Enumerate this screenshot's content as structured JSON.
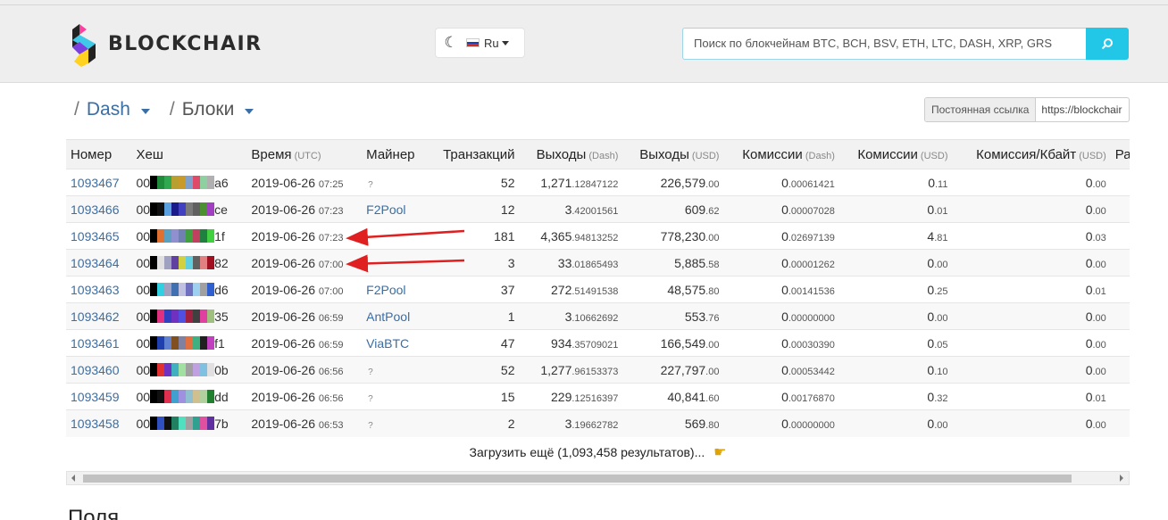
{
  "header": {
    "logo_text": "BLOCKCHAIR",
    "theme_icon": "moon-icon",
    "language": "Ru",
    "search_placeholder": "Поиск по блокчейнам BTC, BCH, BSV, ETH, LTC, DASH, XRP, GRS"
  },
  "breadcrumb": {
    "chain": "Dash",
    "section": "Блоки"
  },
  "permalink": {
    "label": "Постоянная ссылка",
    "value": "https://blockchair"
  },
  "table": {
    "columns": [
      {
        "label": "Номер",
        "unit": ""
      },
      {
        "label": "Хеш",
        "unit": ""
      },
      {
        "label": "Время",
        "unit": "(UTC)"
      },
      {
        "label": "Майнер",
        "unit": ""
      },
      {
        "label": "Транзакций",
        "unit": ""
      },
      {
        "label": "Выходы",
        "unit": "(Dash)"
      },
      {
        "label": "Выходы",
        "unit": "(USD)"
      },
      {
        "label": "Комиссии",
        "unit": "(Dash)"
      },
      {
        "label": "Комиссии",
        "unit": "(USD)"
      },
      {
        "label": "Комиссия/Кбайт",
        "unit": "(USD)"
      },
      {
        "label": "Размер",
        "unit": ""
      }
    ],
    "rows": [
      {
        "id": "1093467",
        "hash_prefix": "00",
        "hash_suffix": "a6",
        "colors": [
          "#000000",
          "#1e8c3a",
          "#2fa84f",
          "#b8a030",
          "#c89a2a",
          "#7fa0c8",
          "#e04a6a",
          "#8fd0a0",
          "#b0b0b0"
        ],
        "date": "2019-06-26",
        "time": "07:25",
        "miner": "?",
        "tx": "52",
        "out_dash_int": "1,271",
        "out_dash_dec": ".12847122",
        "out_usd_int": "226,579",
        "out_usd_dec": ".00",
        "fee_dash_int": "0",
        "fee_dash_dec": ".00061421",
        "fee_usd_int": "0",
        "fee_usd_dec": ".11",
        "fee_kb_int": "0",
        "fee_kb_dec": ".00"
      },
      {
        "id": "1093466",
        "hash_prefix": "00",
        "hash_suffix": "ce",
        "colors": [
          "#000000",
          "#101010",
          "#5aa0e0",
          "#1a1a8a",
          "#4040c0",
          "#7a7a7a",
          "#606060",
          "#4a9030",
          "#a040c0"
        ],
        "date": "2019-06-26",
        "time": "07:23",
        "miner": "F2Pool",
        "tx": "12",
        "out_dash_int": "3",
        "out_dash_dec": ".42001561",
        "out_usd_int": "609",
        "out_usd_dec": ".62",
        "fee_dash_int": "0",
        "fee_dash_dec": ".00007028",
        "fee_usd_int": "0",
        "fee_usd_dec": ".01",
        "fee_kb_int": "0",
        "fee_kb_dec": ".00"
      },
      {
        "id": "1093465",
        "hash_prefix": "00",
        "hash_suffix": "1f",
        "colors": [
          "#000000",
          "#e07030",
          "#5aa0c0",
          "#9090d0",
          "#7080b0",
          "#40a040",
          "#c04060",
          "#208040",
          "#40d040"
        ],
        "date": "2019-06-26",
        "time": "07:23",
        "miner": "",
        "tx": "181",
        "out_dash_int": "4,365",
        "out_dash_dec": ".94813252",
        "out_usd_int": "778,230",
        "out_usd_dec": ".00",
        "fee_dash_int": "0",
        "fee_dash_dec": ".02697139",
        "fee_usd_int": "4",
        "fee_usd_dec": ".81",
        "fee_kb_int": "0",
        "fee_kb_dec": ".03"
      },
      {
        "id": "1093464",
        "hash_prefix": "00",
        "hash_suffix": "82",
        "colors": [
          "#000000",
          "#e0e0e0",
          "#a0a0c0",
          "#6040a0",
          "#d0d040",
          "#60d0e0",
          "#606060",
          "#e08080",
          "#a01020"
        ],
        "date": "2019-06-26",
        "time": "07:00",
        "miner": "",
        "tx": "3",
        "out_dash_int": "33",
        "out_dash_dec": ".01865493",
        "out_usd_int": "5,885",
        "out_usd_dec": ".58",
        "fee_dash_int": "0",
        "fee_dash_dec": ".00001262",
        "fee_usd_int": "0",
        "fee_usd_dec": ".00",
        "fee_kb_int": "0",
        "fee_kb_dec": ".00"
      },
      {
        "id": "1093463",
        "hash_prefix": "00",
        "hash_suffix": "d6",
        "colors": [
          "#000000",
          "#30d0e0",
          "#a0a0c0",
          "#4070b0",
          "#c0c0e0",
          "#7070c0",
          "#a0d0f0",
          "#a0a0a0",
          "#3060d0"
        ],
        "date": "2019-06-26",
        "time": "07:00",
        "miner": "F2Pool",
        "tx": "37",
        "out_dash_int": "272",
        "out_dash_dec": ".51491538",
        "out_usd_int": "48,575",
        "out_usd_dec": ".80",
        "fee_dash_int": "0",
        "fee_dash_dec": ".00141536",
        "fee_usd_int": "0",
        "fee_usd_dec": ".25",
        "fee_kb_int": "0",
        "fee_kb_dec": ".01"
      },
      {
        "id": "1093462",
        "hash_prefix": "00",
        "hash_suffix": "35",
        "colors": [
          "#000000",
          "#e03080",
          "#3040c0",
          "#7030c0",
          "#5050e0",
          "#a02040",
          "#404040",
          "#e040a0",
          "#a0c080"
        ],
        "date": "2019-06-26",
        "time": "06:59",
        "miner": "AntPool",
        "tx": "1",
        "out_dash_int": "3",
        "out_dash_dec": ".10662692",
        "out_usd_int": "553",
        "out_usd_dec": ".76",
        "fee_dash_int": "0",
        "fee_dash_dec": ".00000000",
        "fee_usd_int": "0",
        "fee_usd_dec": ".00",
        "fee_kb_int": "0",
        "fee_kb_dec": ".00"
      },
      {
        "id": "1093461",
        "hash_prefix": "00",
        "hash_suffix": "f1",
        "colors": [
          "#000000",
          "#2040b0",
          "#6080d0",
          "#805020",
          "#8080a0",
          "#e07040",
          "#40b080",
          "#202020",
          "#c040c0"
        ],
        "date": "2019-06-26",
        "time": "06:59",
        "miner": "ViaBTC",
        "tx": "47",
        "out_dash_int": "934",
        "out_dash_dec": ".35709021",
        "out_usd_int": "166,549",
        "out_usd_dec": ".00",
        "fee_dash_int": "0",
        "fee_dash_dec": ".00030390",
        "fee_usd_int": "0",
        "fee_usd_dec": ".05",
        "fee_kb_int": "0",
        "fee_kb_dec": ".00"
      },
      {
        "id": "1093460",
        "hash_prefix": "00",
        "hash_suffix": "0b",
        "colors": [
          "#000000",
          "#e03030",
          "#7030c0",
          "#40b0c0",
          "#a0e0a0",
          "#a0a0a0",
          "#c0a0e0",
          "#80c0e0",
          "#e0e0e0"
        ],
        "date": "2019-06-26",
        "time": "06:56",
        "miner": "?",
        "tx": "52",
        "out_dash_int": "1,277",
        "out_dash_dec": ".96153373",
        "out_usd_int": "227,797",
        "out_usd_dec": ".00",
        "fee_dash_int": "0",
        "fee_dash_dec": ".00053442",
        "fee_usd_int": "0",
        "fee_usd_dec": ".10",
        "fee_kb_int": "0",
        "fee_kb_dec": ".00"
      },
      {
        "id": "1093459",
        "hash_prefix": "00",
        "hash_suffix": "dd",
        "colors": [
          "#000000",
          "#101010",
          "#e03050",
          "#40a0d0",
          "#a090e0",
          "#90c0d0",
          "#d0c090",
          "#b0d0a0",
          "#208030"
        ],
        "date": "2019-06-26",
        "time": "06:56",
        "miner": "?",
        "tx": "15",
        "out_dash_int": "229",
        "out_dash_dec": ".12516397",
        "out_usd_int": "40,841",
        "out_usd_dec": ".60",
        "fee_dash_int": "0",
        "fee_dash_dec": ".00176870",
        "fee_usd_int": "0",
        "fee_usd_dec": ".32",
        "fee_kb_int": "0",
        "fee_kb_dec": ".01"
      },
      {
        "id": "1093458",
        "hash_prefix": "00",
        "hash_suffix": "7b",
        "colors": [
          "#000000",
          "#3050c0",
          "#101010",
          "#208060",
          "#50e0c0",
          "#a0a0a0",
          "#30a090",
          "#e050a0",
          "#6030a0"
        ],
        "date": "2019-06-26",
        "time": "06:53",
        "miner": "?",
        "tx": "2",
        "out_dash_int": "3",
        "out_dash_dec": ".19662782",
        "out_usd_int": "569",
        "out_usd_dec": ".80",
        "fee_dash_int": "0",
        "fee_dash_dec": ".00000000",
        "fee_usd_int": "0",
        "fee_usd_dec": ".00",
        "fee_kb_int": "0",
        "fee_kb_dec": ".00"
      }
    ]
  },
  "load_more": "Загрузить ещё (1,093,458 результатов)...",
  "next_section_title": "Поля",
  "colors": {
    "accent": "#22c7e8",
    "link": "#3a6ea5",
    "annotation_arrow": "#e02020"
  }
}
